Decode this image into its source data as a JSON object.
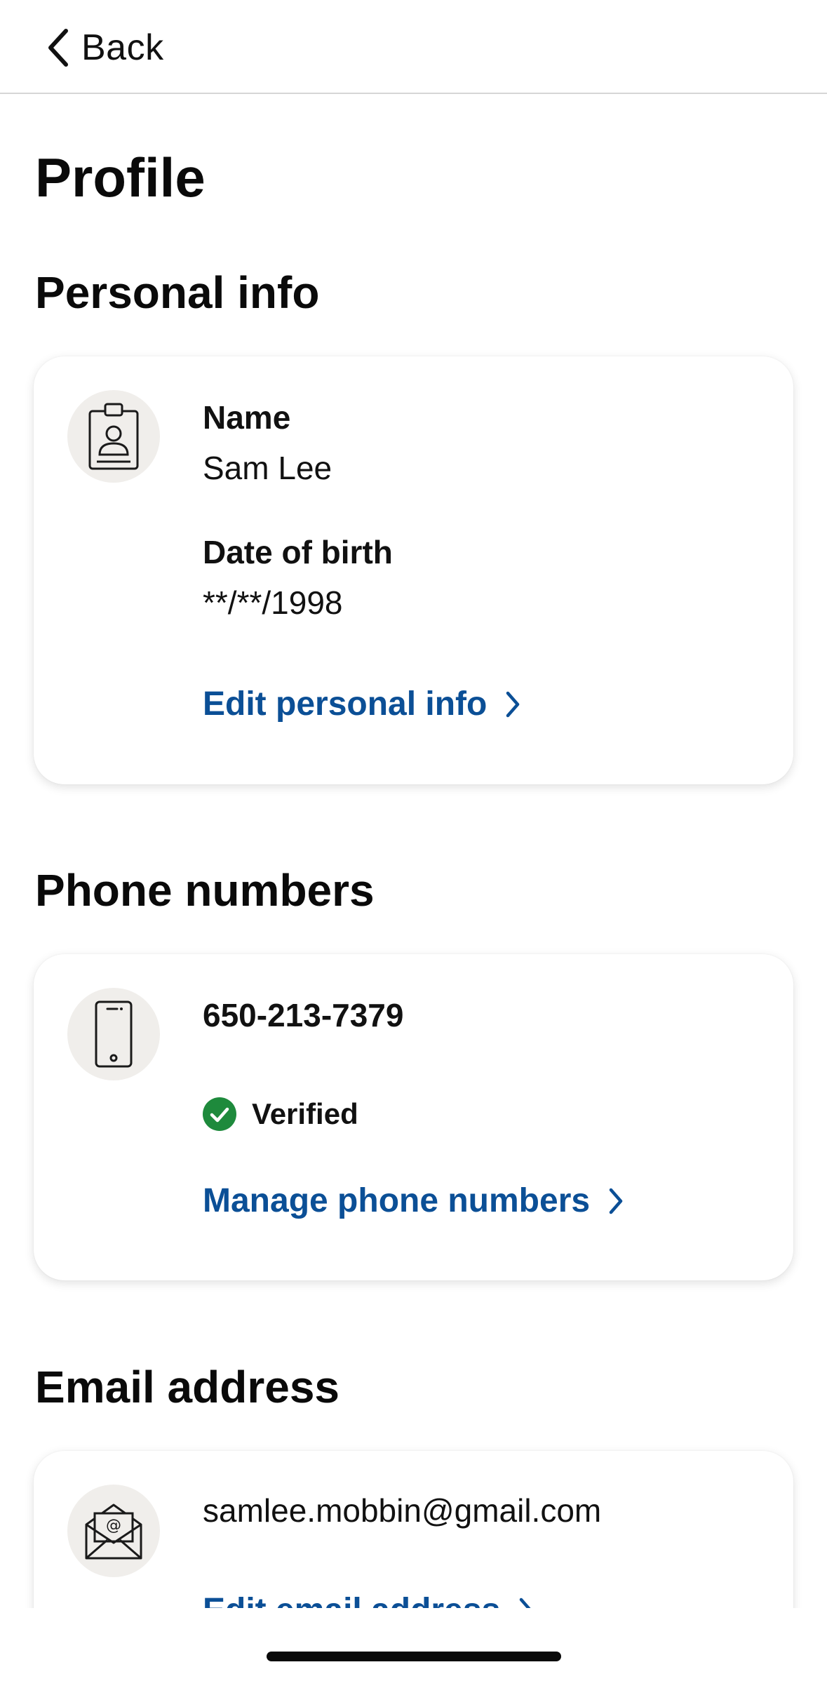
{
  "nav": {
    "back_label": "Back"
  },
  "page": {
    "title": "Profile"
  },
  "personal_info": {
    "section_title": "Personal info",
    "icon": "id-badge-icon",
    "name_label": "Name",
    "name_value": "Sam Lee",
    "dob_label": "Date of birth",
    "dob_value": "**/**/1998",
    "edit_link": "Edit personal info"
  },
  "phone_numbers": {
    "section_title": "Phone numbers",
    "icon": "smartphone-icon",
    "number": "650-213-7379",
    "status": "Verified",
    "manage_link": "Manage phone numbers"
  },
  "email_address": {
    "section_title": "Email address",
    "icon": "email-envelope-icon",
    "email": "samlee.mobbin@gmail.com",
    "edit_link": "Edit email address"
  },
  "colors": {
    "link": "#0b4f96",
    "verified": "#1e8a3c",
    "icon_bg": "#f0eeeb"
  }
}
